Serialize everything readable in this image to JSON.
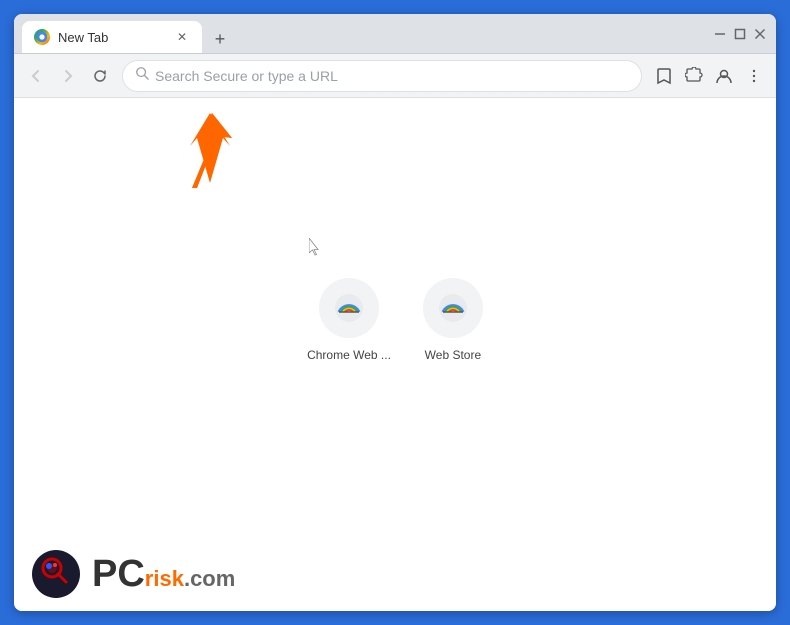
{
  "browser": {
    "tab": {
      "title": "New Tab",
      "favicon": "chrome-icon"
    },
    "new_tab_button": "+",
    "window_controls": {
      "minimize": "−",
      "maximize": "□",
      "close": "✕"
    }
  },
  "toolbar": {
    "back_label": "back",
    "forward_label": "forward",
    "reload_label": "reload",
    "address_placeholder": "Search Secure or type a URL",
    "bookmark_label": "bookmark",
    "extensions_label": "extensions",
    "profile_label": "profile",
    "menu_label": "menu"
  },
  "shortcuts": [
    {
      "id": "chrome-web",
      "label": "Chrome Web ..."
    },
    {
      "id": "web-store",
      "label": "Web Store"
    }
  ],
  "watermark": {
    "pc_text": "PC",
    "risk_text": "risk",
    "domain_text": ".com"
  }
}
